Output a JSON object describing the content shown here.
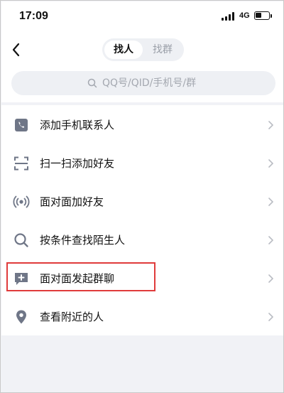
{
  "status_bar": {
    "time": "17:09",
    "network": "4G"
  },
  "nav": {
    "tabs": [
      {
        "label": "找人",
        "active": true
      },
      {
        "label": "找群",
        "active": false
      }
    ]
  },
  "search": {
    "placeholder": "QQ号/QID/手机号/群"
  },
  "menu": {
    "items": [
      {
        "label": "添加手机联系人",
        "icon": "phone-icon"
      },
      {
        "label": "扫一扫添加好友",
        "icon": "scan-icon"
      },
      {
        "label": "面对面加好友",
        "icon": "face-to-face-icon"
      },
      {
        "label": "按条件查找陌生人",
        "icon": "search-icon"
      },
      {
        "label": "面对面发起群聊",
        "icon": "group-chat-add-icon",
        "highlighted": true
      },
      {
        "label": "查看附近的人",
        "icon": "location-pin-icon"
      }
    ]
  },
  "colors": {
    "icon": "#6f7687",
    "highlight": "#e03b3b",
    "background": "#f1f2f6"
  }
}
